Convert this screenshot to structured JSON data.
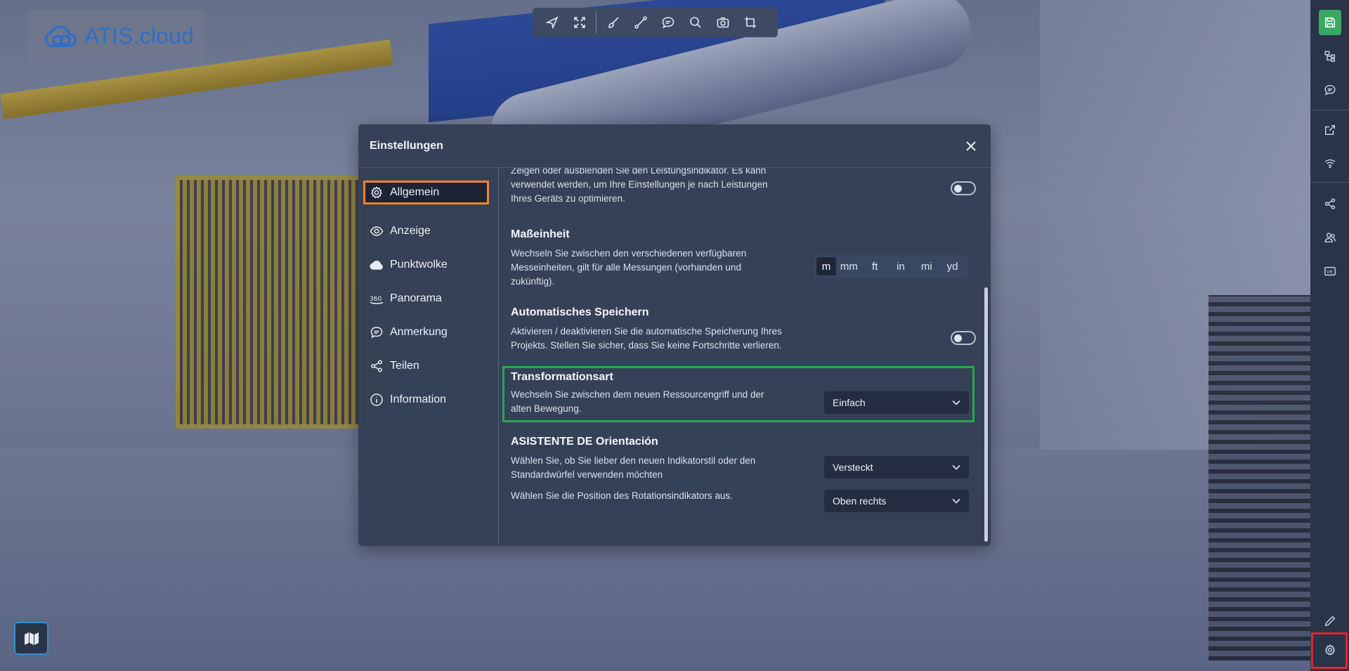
{
  "brand": {
    "logo_text": "ATIS.cloud",
    "logo_color": "#2f6ec9"
  },
  "toolbar": {
    "tools": [
      {
        "name": "select",
        "icon": "cursor-arrow-icon"
      },
      {
        "name": "fit",
        "icon": "expand-arrows-icon"
      },
      {
        "name": "paint",
        "icon": "brush-icon"
      },
      {
        "name": "measure",
        "icon": "measure-line-icon"
      },
      {
        "name": "comment",
        "icon": "chat-bubble-icon"
      },
      {
        "name": "search",
        "icon": "search-icon"
      },
      {
        "name": "camera",
        "icon": "camera-icon"
      },
      {
        "name": "crop",
        "icon": "crop-icon"
      }
    ]
  },
  "settings_dialog": {
    "title": "Einstellungen",
    "nav": [
      {
        "label": "Allgemein",
        "icon": "gear-icon",
        "active": true
      },
      {
        "label": "Anzeige",
        "icon": "eye-icon"
      },
      {
        "label": "Punktwolke",
        "icon": "cloud-icon"
      },
      {
        "label": "Panorama",
        "icon": "panorama-360-icon"
      },
      {
        "label": "Anmerkung",
        "icon": "comment-icon"
      },
      {
        "label": "Teilen",
        "icon": "share-icon"
      },
      {
        "label": "Information",
        "icon": "info-icon"
      }
    ],
    "performance": {
      "desc_partial": "Zeigen oder ausblenden Sie den Leistungsindikator. Es kann verwendet werden, um Ihre Einstellungen je nach Leistungen Ihres Geräts zu optimieren.",
      "enabled": false
    },
    "units": {
      "title": "Maßeinheit",
      "desc": "Wechseln Sie zwischen den verschiedenen verfügbaren Messeinheiten, gilt für alle Messungen (vorhanden und zukünftig).",
      "options": [
        "m",
        "mm",
        "ft",
        "in",
        "mi",
        "yd"
      ],
      "selected": "m"
    },
    "autosave": {
      "title": "Automatisches Speichern",
      "desc": "Aktivieren / deaktivieren Sie die automatische Speicherung Ihres Projekts. Stellen Sie sicher, dass Sie keine Fortschritte verlieren.",
      "enabled": false
    },
    "transform": {
      "title": "Transformationsart",
      "desc": "Wechseln Sie zwischen dem neuen Ressourcengriff und der alten Bewegung.",
      "value": "Einfach"
    },
    "orientation": {
      "title": "ASISTENTE DE Orientación",
      "desc": "Wählen Sie, ob Sie lieber den neuen Indikatorstil oder den Standardwürfel verwenden möchten",
      "value": "Versteckt",
      "position_desc": "Wählen Sie die Position des Rotationsindikators aus.",
      "position_value": "Oben rechts"
    }
  },
  "sidebar": {
    "items": [
      {
        "icon": "save-icon",
        "accent": "#39a862"
      },
      {
        "icon": "tree-structure-icon"
      },
      {
        "icon": "chat-icon"
      },
      {
        "icon": "external-link-icon"
      },
      {
        "icon": "wifi-icon"
      },
      {
        "icon": "share-icon"
      },
      {
        "icon": "users-icon"
      },
      {
        "icon": "vr-icon"
      },
      {
        "icon": "pencil-icon"
      },
      {
        "icon": "gear-icon"
      }
    ]
  },
  "colors": {
    "highlight_orange": "#f08428",
    "highlight_green": "#27a84a",
    "highlight_red": "#e1252f"
  }
}
